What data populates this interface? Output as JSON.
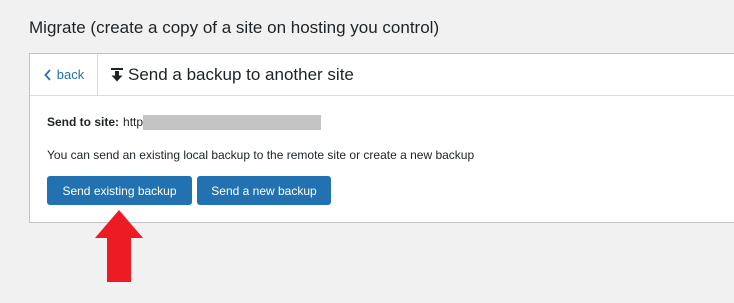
{
  "page": {
    "title": "Migrate (create a copy of a site on hosting you control)"
  },
  "panel": {
    "back_label": "back",
    "header_title": "Send a backup to another site",
    "header_icon": "upload-arrow-icon",
    "send_to_label": "Send to site:",
    "send_to_value": "http",
    "info_text": "You can send an existing local backup to the remote site or create a new backup",
    "buttons": {
      "existing": "Send existing backup",
      "new": "Send a new backup"
    }
  },
  "colors": {
    "background": "#f1f1f1",
    "primary_button": "#2271b1",
    "link": "#2271b1",
    "annotation_arrow": "#ed1c24"
  }
}
